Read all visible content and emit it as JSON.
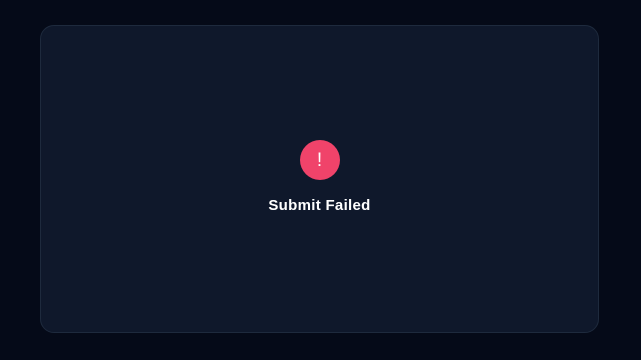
{
  "dialog": {
    "icon": {
      "name": "error-exclamation-icon",
      "glyph": "!",
      "color": "#f0436a"
    },
    "title": "Submit Failed"
  },
  "colors": {
    "background": "#050a18",
    "panel": "#0f182b",
    "panel_border": "#1e2a3d",
    "error_accent": "#f0436a",
    "text": "#ffffff"
  }
}
